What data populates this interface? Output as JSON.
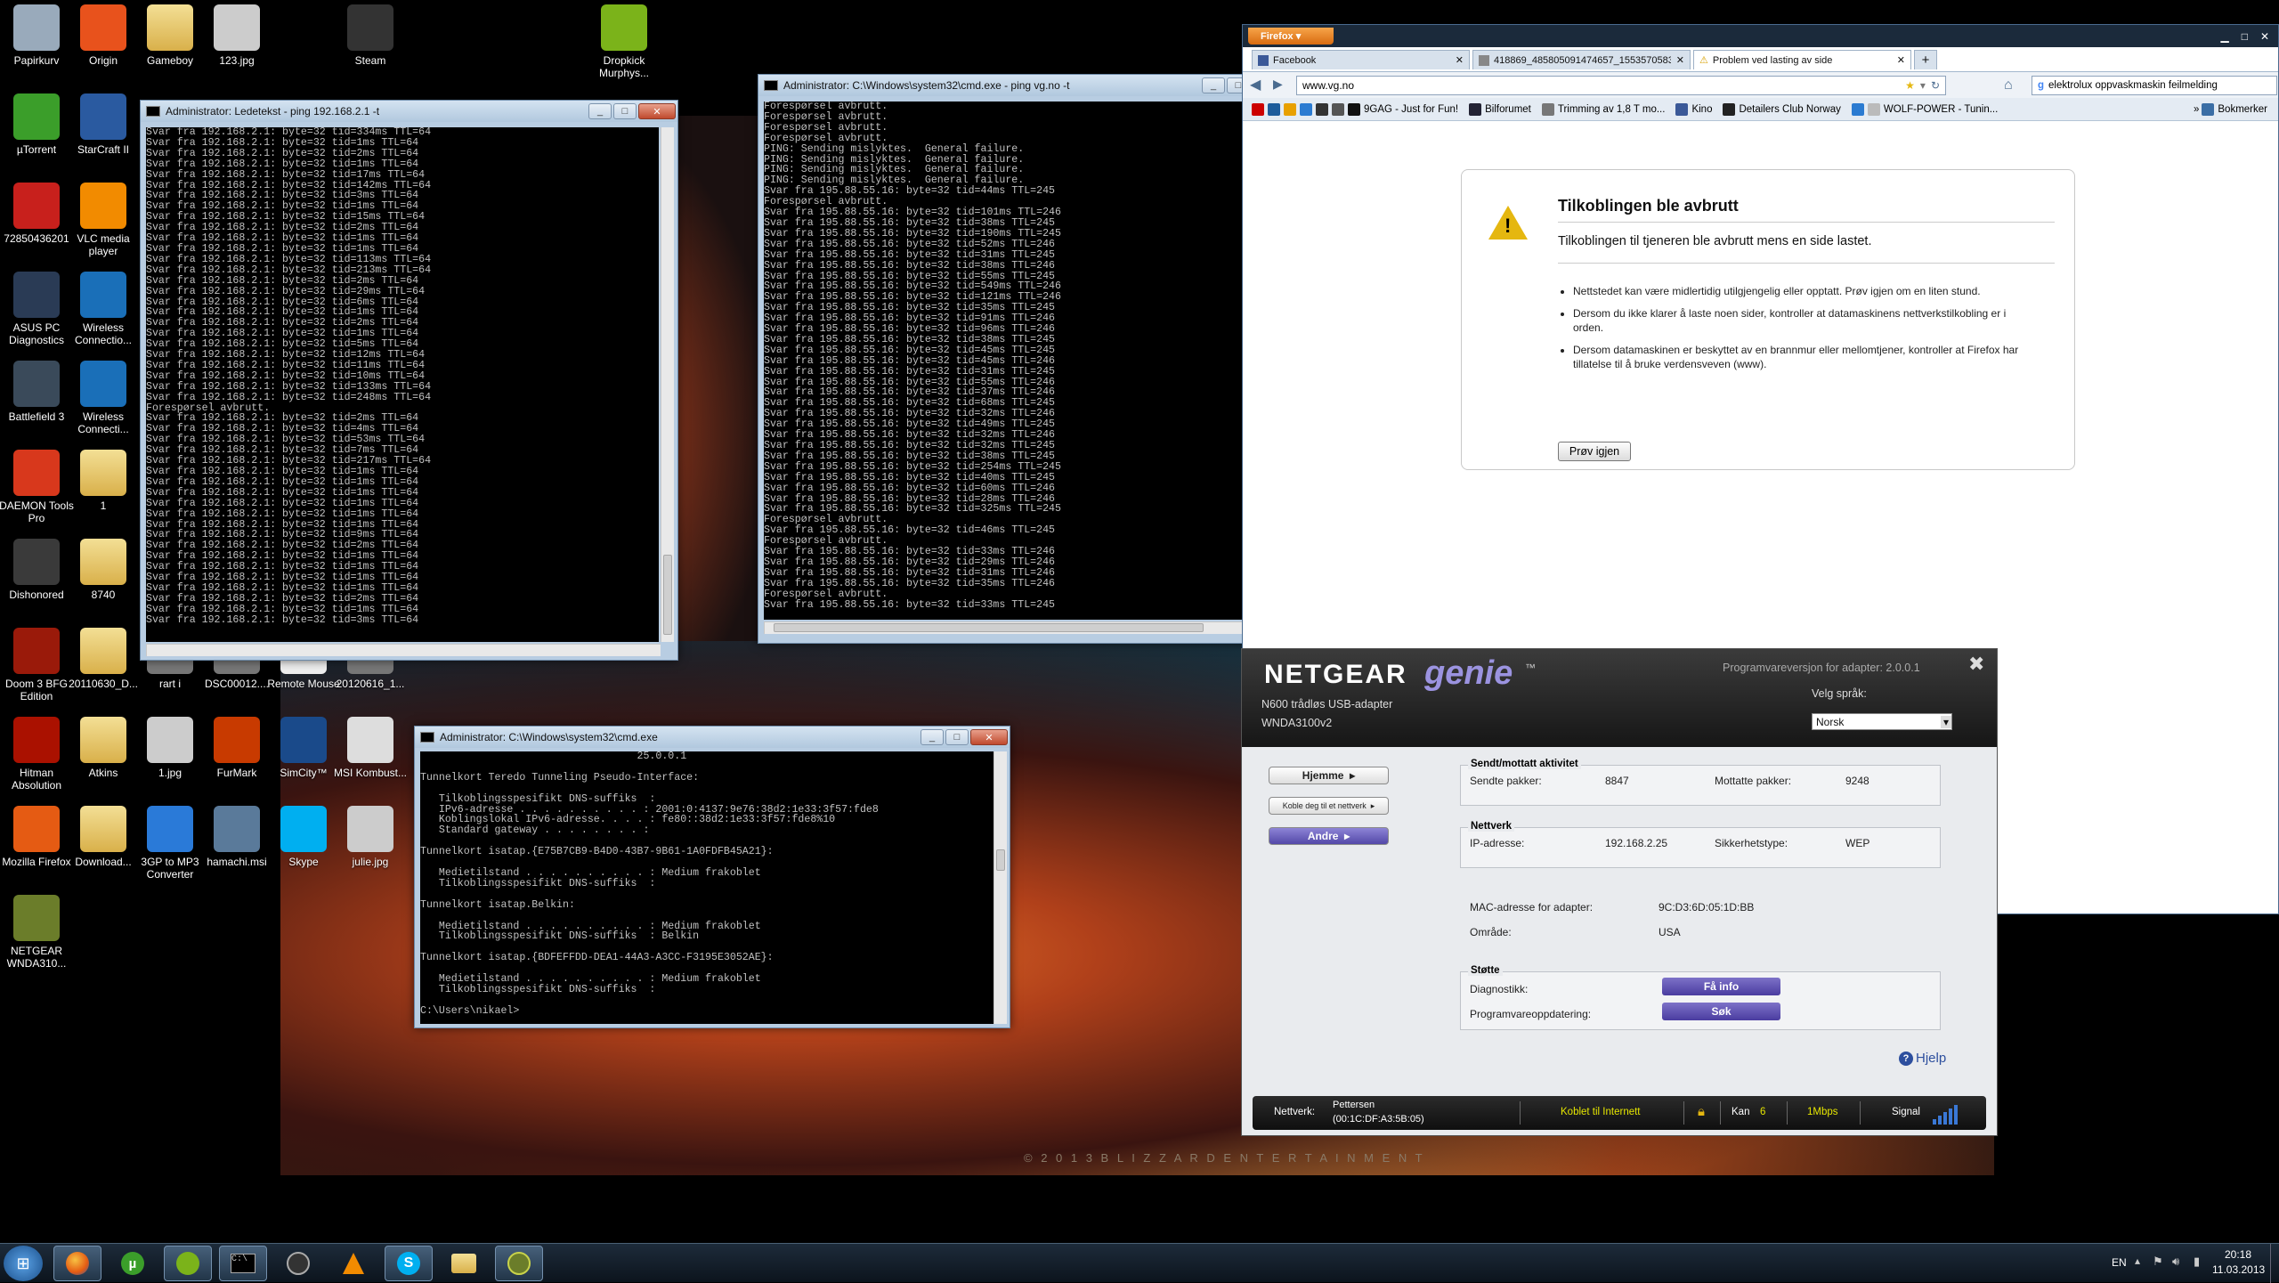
{
  "desktop": {
    "icons": [
      {
        "label": "Papirkurv",
        "icon": "recycle-bin-icon"
      },
      {
        "label": "Origin",
        "icon": "origin-icon"
      },
      {
        "label": "Gameboy",
        "icon": "folder-icon"
      },
      {
        "label": "123.jpg",
        "icon": "image-file-icon"
      },
      {
        "label": "Steam",
        "icon": "steam-icon"
      },
      {
        "label": "Dropkick Murphys...",
        "icon": "spotify-icon"
      },
      {
        "label": "µTorrent",
        "icon": "utorrent-icon"
      },
      {
        "label": "StarCraft II",
        "icon": "starcraft-icon"
      },
      {
        "label": "72850436201",
        "icon": "pdf-icon"
      },
      {
        "label": "VLC media player",
        "icon": "vlc-icon"
      },
      {
        "label": "ASUS PC Diagnostics",
        "icon": "asus-icon"
      },
      {
        "label": "Wireless Connectio...",
        "icon": "dlink-icon"
      },
      {
        "label": "Battlefield 3",
        "icon": "battlefield-icon"
      },
      {
        "label": "Wireless Connecti...",
        "icon": "dlink-icon"
      },
      {
        "label": "DAEMON Tools Pro",
        "icon": "daemon-icon"
      },
      {
        "label": "1",
        "icon": "folder-icon"
      },
      {
        "label": "Dishonored",
        "icon": "dishonored-icon"
      },
      {
        "label": "8740",
        "icon": "folder-icon"
      },
      {
        "label": "Doom 3 BFG Edition",
        "icon": "doom-icon"
      },
      {
        "label": "20110630_D...",
        "icon": "folder-icon"
      },
      {
        "label": "rart i",
        "icon": "file-icon"
      },
      {
        "label": "DSC00012....",
        "icon": "file-icon"
      },
      {
        "label": "Remote Mouse",
        "icon": "remote-mouse-icon"
      },
      {
        "label": "20120616_1...",
        "icon": "file-icon"
      },
      {
        "label": "Hitman Absolution",
        "icon": "hitman-icon"
      },
      {
        "label": "Atkins",
        "icon": "folder-icon"
      },
      {
        "label": "1.jpg",
        "icon": "image-file-icon"
      },
      {
        "label": "FurMark",
        "icon": "furmark-icon"
      },
      {
        "label": "SimCity™",
        "icon": "simcity-icon"
      },
      {
        "label": "MSI Kombust...",
        "icon": "msi-icon"
      },
      {
        "label": "Mozilla Firefox",
        "icon": "firefox-icon"
      },
      {
        "label": "Download...",
        "icon": "folder-icon"
      },
      {
        "label": "3GP to MP3 Converter",
        "icon": "music-icon"
      },
      {
        "label": "hamachi.msi",
        "icon": "installer-icon"
      },
      {
        "label": "Skype",
        "icon": "skype-icon"
      },
      {
        "label": "julie.jpg",
        "icon": "image-file-icon"
      },
      {
        "label": "NETGEAR WNDA310...",
        "icon": "netgear-icon"
      }
    ],
    "watermark": "© 2 0 1 3   B L I Z Z A R D   E N T E R T A I N M E N T"
  },
  "cmd1": {
    "title": "Administrator: Ledetekst - ping  192.168.2.1 -t",
    "lines": [
      "Svar fra 192.168.2.1: byte=32 tid=334ms TTL=64",
      "Svar fra 192.168.2.1: byte=32 tid=1ms TTL=64",
      "Svar fra 192.168.2.1: byte=32 tid=2ms TTL=64",
      "Svar fra 192.168.2.1: byte=32 tid=1ms TTL=64",
      "Svar fra 192.168.2.1: byte=32 tid=17ms TTL=64",
      "Svar fra 192.168.2.1: byte=32 tid=142ms TTL=64",
      "Svar fra 192.168.2.1: byte=32 tid=3ms TTL=64",
      "Svar fra 192.168.2.1: byte=32 tid=1ms TTL=64",
      "Svar fra 192.168.2.1: byte=32 tid=15ms TTL=64",
      "Svar fra 192.168.2.1: byte=32 tid=2ms TTL=64",
      "Svar fra 192.168.2.1: byte=32 tid=1ms TTL=64",
      "Svar fra 192.168.2.1: byte=32 tid=1ms TTL=64",
      "Svar fra 192.168.2.1: byte=32 tid=113ms TTL=64",
      "Svar fra 192.168.2.1: byte=32 tid=213ms TTL=64",
      "Svar fra 192.168.2.1: byte=32 tid=2ms TTL=64",
      "Svar fra 192.168.2.1: byte=32 tid=29ms TTL=64",
      "Svar fra 192.168.2.1: byte=32 tid=6ms TTL=64",
      "Svar fra 192.168.2.1: byte=32 tid=1ms TTL=64",
      "Svar fra 192.168.2.1: byte=32 tid=2ms TTL=64",
      "Svar fra 192.168.2.1: byte=32 tid=1ms TTL=64",
      "Svar fra 192.168.2.1: byte=32 tid=5ms TTL=64",
      "Svar fra 192.168.2.1: byte=32 tid=12ms TTL=64",
      "Svar fra 192.168.2.1: byte=32 tid=11ms TTL=64",
      "Svar fra 192.168.2.1: byte=32 tid=10ms TTL=64",
      "Svar fra 192.168.2.1: byte=32 tid=133ms TTL=64",
      "Svar fra 192.168.2.1: byte=32 tid=248ms TTL=64",
      "Forespørsel avbrutt.",
      "Svar fra 192.168.2.1: byte=32 tid=2ms TTL=64",
      "Svar fra 192.168.2.1: byte=32 tid=4ms TTL=64",
      "Svar fra 192.168.2.1: byte=32 tid=53ms TTL=64",
      "Svar fra 192.168.2.1: byte=32 tid=7ms TTL=64",
      "Svar fra 192.168.2.1: byte=32 tid=217ms TTL=64",
      "Svar fra 192.168.2.1: byte=32 tid=1ms TTL=64",
      "Svar fra 192.168.2.1: byte=32 tid=1ms TTL=64",
      "Svar fra 192.168.2.1: byte=32 tid=1ms TTL=64",
      "Svar fra 192.168.2.1: byte=32 tid=1ms TTL=64",
      "Svar fra 192.168.2.1: byte=32 tid=1ms TTL=64",
      "Svar fra 192.168.2.1: byte=32 tid=1ms TTL=64",
      "Svar fra 192.168.2.1: byte=32 tid=9ms TTL=64",
      "Svar fra 192.168.2.1: byte=32 tid=2ms TTL=64",
      "Svar fra 192.168.2.1: byte=32 tid=1ms TTL=64",
      "Svar fra 192.168.2.1: byte=32 tid=1ms TTL=64",
      "Svar fra 192.168.2.1: byte=32 tid=1ms TTL=64",
      "Svar fra 192.168.2.1: byte=32 tid=1ms TTL=64",
      "Svar fra 192.168.2.1: byte=32 tid=2ms TTL=64",
      "Svar fra 192.168.2.1: byte=32 tid=1ms TTL=64",
      "Svar fra 192.168.2.1: byte=32 tid=3ms TTL=64"
    ]
  },
  "cmd2": {
    "title": "Administrator: C:\\Windows\\system32\\cmd.exe - ping  vg.no -t",
    "lines": [
      "Forespørsel avbrutt.",
      "Forespørsel avbrutt.",
      "Forespørsel avbrutt.",
      "Forespørsel avbrutt.",
      "PING: Sending mislyktes.  General failure.",
      "PING: Sending mislyktes.  General failure.",
      "PING: Sending mislyktes.  General failure.",
      "PING: Sending mislyktes.  General failure.",
      "Svar fra 195.88.55.16: byte=32 tid=44ms TTL=245",
      "Forespørsel avbrutt.",
      "Svar fra 195.88.55.16: byte=32 tid=101ms TTL=246",
      "Svar fra 195.88.55.16: byte=32 tid=38ms TTL=245",
      "Svar fra 195.88.55.16: byte=32 tid=190ms TTL=245",
      "Svar fra 195.88.55.16: byte=32 tid=52ms TTL=246",
      "Svar fra 195.88.55.16: byte=32 tid=31ms TTL=245",
      "Svar fra 195.88.55.16: byte=32 tid=38ms TTL=246",
      "Svar fra 195.88.55.16: byte=32 tid=55ms TTL=245",
      "Svar fra 195.88.55.16: byte=32 tid=549ms TTL=246",
      "Svar fra 195.88.55.16: byte=32 tid=121ms TTL=246",
      "Svar fra 195.88.55.16: byte=32 tid=35ms TTL=245",
      "Svar fra 195.88.55.16: byte=32 tid=91ms TTL=246",
      "Svar fra 195.88.55.16: byte=32 tid=96ms TTL=246",
      "Svar fra 195.88.55.16: byte=32 tid=38ms TTL=245",
      "Svar fra 195.88.55.16: byte=32 tid=45ms TTL=245",
      "Svar fra 195.88.55.16: byte=32 tid=45ms TTL=246",
      "Svar fra 195.88.55.16: byte=32 tid=31ms TTL=245",
      "Svar fra 195.88.55.16: byte=32 tid=55ms TTL=246",
      "Svar fra 195.88.55.16: byte=32 tid=37ms TTL=246",
      "Svar fra 195.88.55.16: byte=32 tid=68ms TTL=245",
      "Svar fra 195.88.55.16: byte=32 tid=32ms TTL=246",
      "Svar fra 195.88.55.16: byte=32 tid=49ms TTL=245",
      "Svar fra 195.88.55.16: byte=32 tid=32ms TTL=246",
      "Svar fra 195.88.55.16: byte=32 tid=32ms TTL=245",
      "Svar fra 195.88.55.16: byte=32 tid=38ms TTL=245",
      "Svar fra 195.88.55.16: byte=32 tid=254ms TTL=245",
      "Svar fra 195.88.55.16: byte=32 tid=40ms TTL=245",
      "Svar fra 195.88.55.16: byte=32 tid=60ms TTL=246",
      "Svar fra 195.88.55.16: byte=32 tid=28ms TTL=246",
      "Svar fra 195.88.55.16: byte=32 tid=325ms TTL=245",
      "Forespørsel avbrutt.",
      "Svar fra 195.88.55.16: byte=32 tid=46ms TTL=245",
      "Forespørsel avbrutt.",
      "Svar fra 195.88.55.16: byte=32 tid=33ms TTL=246",
      "Svar fra 195.88.55.16: byte=32 tid=29ms TTL=246",
      "Svar fra 195.88.55.16: byte=32 tid=31ms TTL=246",
      "Svar fra 195.88.55.16: byte=32 tid=35ms TTL=246",
      "Forespørsel avbrutt.",
      "Svar fra 195.88.55.16: byte=32 tid=33ms TTL=245"
    ]
  },
  "cmd3": {
    "title": "Administrator: C:\\Windows\\system32\\cmd.exe",
    "lines": [
      "                                   25.0.0.1",
      "",
      "Tunnelkort Teredo Tunneling Pseudo-Interface:",
      "",
      "   Tilkoblingsspesifikt DNS-suffiks  :",
      "   IPv6-adresse . . . . . . . . . . : 2001:0:4137:9e76:38d2:1e33:3f57:fde8",
      "   Koblingslokal IPv6-adresse. . . . : fe80::38d2:1e33:3f57:fde8%10",
      "   Standard gateway . . . . . . . . :",
      "",
      "Tunnelkort isatap.{E75B7CB9-B4D0-43B7-9B61-1A0FDFB45A21}:",
      "",
      "   Medietilstand . . . . . . . . . . : Medium frakoblet",
      "   Tilkoblingsspesifikt DNS-suffiks  :",
      "",
      "Tunnelkort isatap.Belkin:",
      "",
      "   Medietilstand . . . . . . . . . . : Medium frakoblet",
      "   Tilkoblingsspesifikt DNS-suffiks  : Belkin",
      "",
      "Tunnelkort isatap.{BDFEFFDD-DEA1-44A3-A3CC-F3195E3052AE}:",
      "",
      "   Medietilstand . . . . . . . . . . : Medium frakoblet",
      "   Tilkoblingsspesifikt DNS-suffiks  :",
      "",
      "C:\\Users\\nikael>"
    ]
  },
  "firefox": {
    "menu_label": "Firefox",
    "tabs": [
      "Facebook",
      "418869_485805091474657_1553570583...",
      "Problem ved lasting av side"
    ],
    "url": "www.vg.no",
    "search": "elektrolux oppvaskmaskin feilmelding",
    "bookmarks": [
      "9GAG - Just for Fun!",
      "Bilforumet",
      "Trimming av 1,8 T mo...",
      "Kino",
      "Detailers Club Norway",
      "WOLF-POWER - Tunin...",
      "Bokmerker"
    ],
    "error": {
      "title": "Tilkoblingen ble avbrutt",
      "subtitle": "Tilkoblingen til tjeneren ble avbrutt mens en side lastet.",
      "bullets": [
        "Nettstedet kan være midlertidig utilgjengelig eller opptatt. Prøv igjen om en liten stund.",
        "Dersom du ikke klarer å laste noen sider, kontroller at datamaskinens nettverkstilkobling er i orden.",
        "Dersom datamaskinen er beskyttet av en brannmur eller mellomtjener, kontroller at Firefox har tillatelse til å bruke verdensveven (www)."
      ],
      "retry": "Prøv igjen"
    }
  },
  "netgear": {
    "brand": "NETGEAR",
    "genie": "genie",
    "tm": "™",
    "model": "N600 trådløs USB-adapter",
    "model2": "WNDA3100v2",
    "version": "Programvareversjon for adapter: 2.0.0.1",
    "lang_label": "Velg språk:",
    "lang": "Norsk",
    "nav": [
      "Hjemme",
      "Koble deg til et nettverk",
      "Andre"
    ],
    "stats_title": "Sendt/mottatt aktivitet",
    "sent_label": "Sendte pakker:",
    "sent": "8847",
    "recv_label": "Mottatte pakker:",
    "recv": "9248",
    "net_title": "Nettverk",
    "ip_label": "IP-adresse:",
    "ip": "192.168.2.25",
    "sec_label": "Sikkerhetstype:",
    "sec": "WEP",
    "mac_label": "MAC-adresse for adapter:",
    "mac": "9C:D3:6D:05:1D:BB",
    "region_label": "Område:",
    "region": "USA",
    "support_title": "Støtte",
    "diag_label": "Diagnostikk:",
    "diag_btn": "Få info",
    "upd_label": "Programvareoppdatering:",
    "upd_btn": "Søk",
    "help": "Hjelp",
    "bar": {
      "net_label": "Nettverk:",
      "ssid": "Pettersen",
      "bssid": "(00:1C:DF:A3:5B:05)",
      "status": "Koblet til Internett",
      "ch_label": "Kan",
      "ch": "6",
      "speed": "1Mbps",
      "signal_label": "Signal"
    }
  },
  "taskbar": {
    "lang": "EN",
    "time": "20:18",
    "date": "11.03.2013"
  }
}
